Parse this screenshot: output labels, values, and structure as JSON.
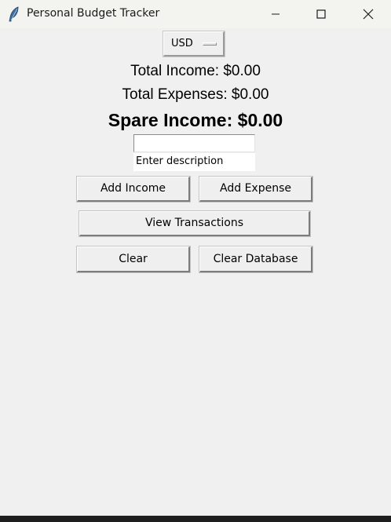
{
  "window": {
    "title": "Personal Budget Tracker",
    "icon": "feather-icon",
    "controls": [
      "minimize-icon",
      "maximize-icon",
      "close-icon"
    ]
  },
  "currency": {
    "selected": "USD"
  },
  "totals": {
    "income": "Total Income: $0.00",
    "expenses": "Total Expenses: $0.00",
    "spare": "Spare Income: $0.00"
  },
  "form": {
    "amount_value": "",
    "description_value": "Enter description"
  },
  "buttons": {
    "add_income": "Add Income",
    "add_expense": "Add Expense",
    "view_transactions": "View Transactions",
    "clear": "Clear",
    "clear_database": "Clear Database"
  },
  "colors": {
    "background": "#f0f0f0",
    "titlebar": "#f3f3ef"
  }
}
